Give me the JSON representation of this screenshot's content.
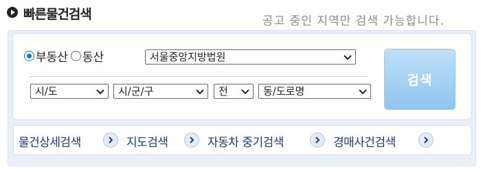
{
  "header": {
    "title": "빠른물건검색",
    "note": "공고 중인 지역만 검색 가능합니다."
  },
  "radios": [
    {
      "label": "부동산",
      "checked": true
    },
    {
      "label": "동산",
      "checked": false
    }
  ],
  "court_select": {
    "value": "서울중앙지방법원"
  },
  "region": {
    "sido": "시/도",
    "gungu": "시/군/구",
    "type": "전",
    "dong": "동/도로명"
  },
  "search_button": {
    "label": "검색"
  },
  "links": [
    {
      "label": "물건상세검색"
    },
    {
      "label": "지도검색"
    },
    {
      "label": "자동차 중기검색"
    },
    {
      "label": "경매사건검색"
    }
  ],
  "colors": {
    "accent": "#1a73e8",
    "link": "#1a3a7a",
    "button": "#8fc5ef"
  }
}
